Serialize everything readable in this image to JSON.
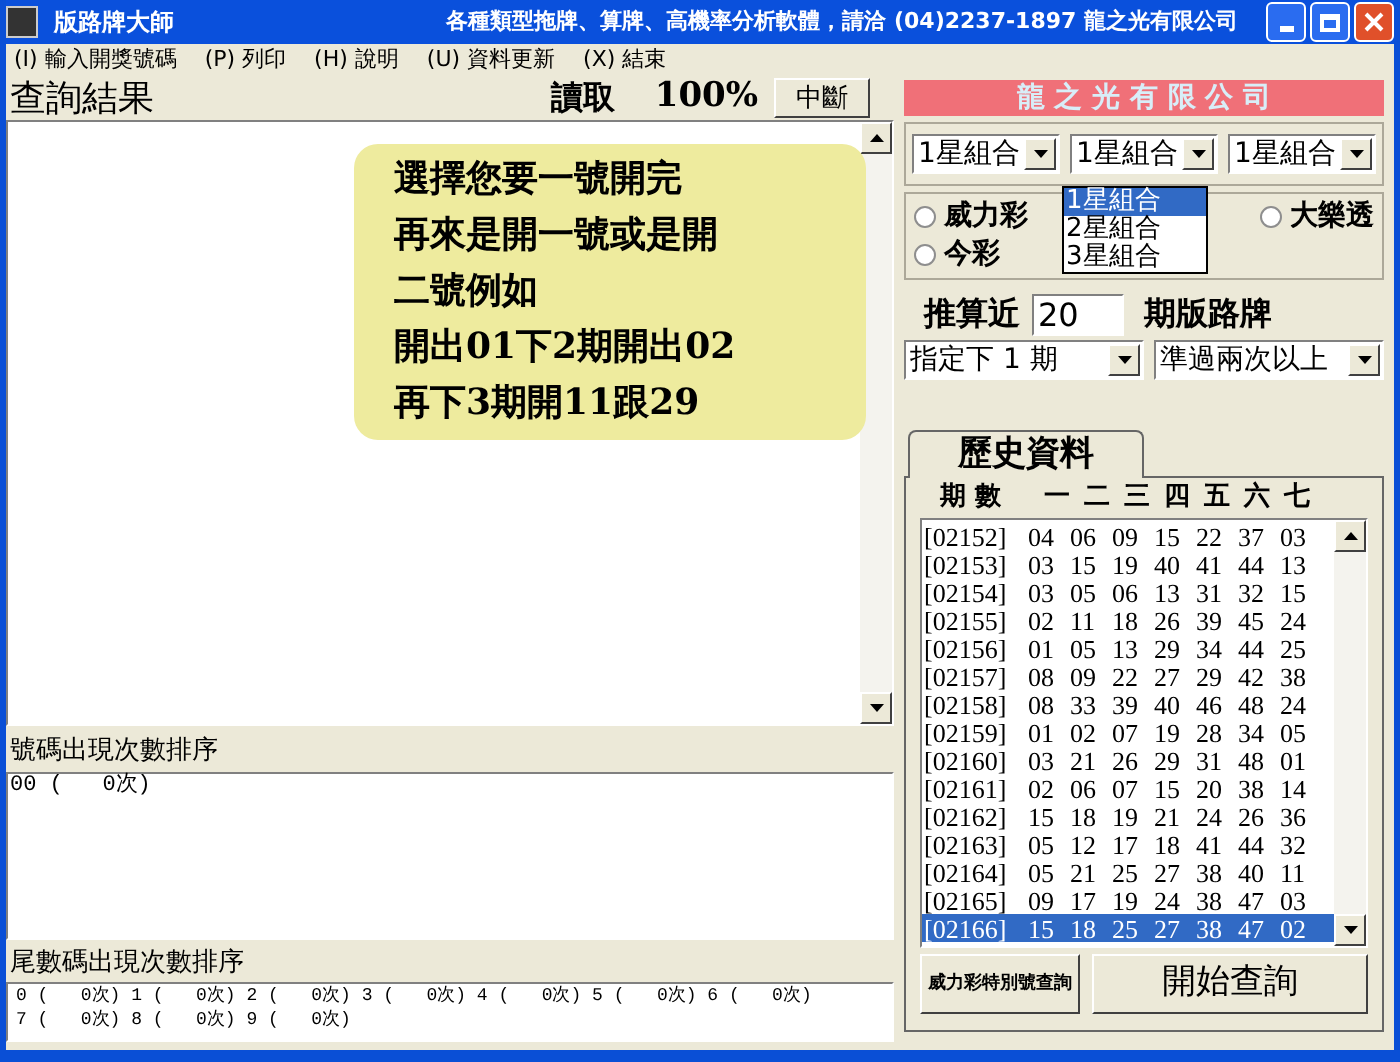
{
  "window": {
    "title": "版路牌大師",
    "caption": "各種類型拖牌、算牌、高機率分析軟體，請洽  (04)2237-1897  龍之光有限公司"
  },
  "menu": [
    {
      "key": "(I)",
      "label": "輸入開獎號碼"
    },
    {
      "key": "(P)",
      "label": "列印"
    },
    {
      "key": "(H)",
      "label": "說明"
    },
    {
      "key": "(U)",
      "label": "資料更新"
    },
    {
      "key": "(X)",
      "label": "結束"
    }
  ],
  "results": {
    "title": "查詢結果",
    "status": "讀取",
    "percent": "100%",
    "stop_button": "中斷"
  },
  "tooltip": {
    "lines": [
      "選擇您要一號開完",
      "再來是開一號或是開",
      "二號例如",
      "開出01下2期開出02",
      "再下3期開11跟29"
    ]
  },
  "number_counts": {
    "title": "號碼出現次數排序",
    "lines": [
      "00 (   0次)"
    ]
  },
  "tail_counts": {
    "title": "尾數碼出現次數排序",
    "lines": [
      "0 (   0次) 1 (   0次) 2 (   0次) 3 (   0次) 4 (   0次) 5 (   0次) 6 (   0次)",
      "7 (   0次) 8 (   0次) 9 (   0次)"
    ]
  },
  "company": "龍 之 光 有 限 公 司",
  "combos": [
    {
      "value": "1星組合"
    },
    {
      "value": "1星組合",
      "expanded": true
    },
    {
      "value": "1星組合"
    }
  ],
  "combo_options": [
    {
      "label": "1星組合",
      "selected": true
    },
    {
      "label": "2星組合",
      "selected": false
    },
    {
      "label": "3星組合",
      "selected": false
    }
  ],
  "games": [
    {
      "label": "威力彩",
      "selected": false
    },
    {
      "label": "今彩",
      "selected": false
    },
    {
      "label": "大樂透",
      "selected": false
    }
  ],
  "recent": {
    "label": "推算近",
    "value": "20",
    "suffix": "期版路牌"
  },
  "filters": [
    {
      "value": "指定下 1 期"
    },
    {
      "value": "準過兩次以上"
    }
  ],
  "history": {
    "tab": "歷史資料",
    "columns": [
      "期 數",
      "一",
      "二",
      "三",
      "四",
      "五",
      "六",
      "七"
    ],
    "rows": [
      {
        "period": "[02152]",
        "numbers": [
          "04",
          "06",
          "09",
          "15",
          "22",
          "37",
          "03"
        ],
        "selected": false
      },
      {
        "period": "[02153]",
        "numbers": [
          "03",
          "15",
          "19",
          "40",
          "41",
          "44",
          "13"
        ],
        "selected": false
      },
      {
        "period": "[02154]",
        "numbers": [
          "03",
          "05",
          "06",
          "13",
          "31",
          "32",
          "15"
        ],
        "selected": false
      },
      {
        "period": "[02155]",
        "numbers": [
          "02",
          "11",
          "18",
          "26",
          "39",
          "45",
          "24"
        ],
        "selected": false
      },
      {
        "period": "[02156]",
        "numbers": [
          "01",
          "05",
          "13",
          "29",
          "34",
          "44",
          "25"
        ],
        "selected": false
      },
      {
        "period": "[02157]",
        "numbers": [
          "08",
          "09",
          "22",
          "27",
          "29",
          "42",
          "38"
        ],
        "selected": false
      },
      {
        "period": "[02158]",
        "numbers": [
          "08",
          "33",
          "39",
          "40",
          "46",
          "48",
          "24"
        ],
        "selected": false
      },
      {
        "period": "[02159]",
        "numbers": [
          "01",
          "02",
          "07",
          "19",
          "28",
          "34",
          "05"
        ],
        "selected": false
      },
      {
        "period": "[02160]",
        "numbers": [
          "03",
          "21",
          "26",
          "29",
          "31",
          "48",
          "01"
        ],
        "selected": false
      },
      {
        "period": "[02161]",
        "numbers": [
          "02",
          "06",
          "07",
          "15",
          "20",
          "38",
          "14"
        ],
        "selected": false
      },
      {
        "period": "[02162]",
        "numbers": [
          "15",
          "18",
          "19",
          "21",
          "24",
          "26",
          "36"
        ],
        "selected": false
      },
      {
        "period": "[02163]",
        "numbers": [
          "05",
          "12",
          "17",
          "18",
          "41",
          "44",
          "32"
        ],
        "selected": false
      },
      {
        "period": "[02164]",
        "numbers": [
          "05",
          "21",
          "25",
          "27",
          "38",
          "40",
          "11"
        ],
        "selected": false
      },
      {
        "period": "[02165]",
        "numbers": [
          "09",
          "17",
          "19",
          "24",
          "38",
          "47",
          "03"
        ],
        "selected": false
      },
      {
        "period": "[02166]",
        "numbers": [
          "15",
          "18",
          "25",
          "27",
          "38",
          "47",
          "02"
        ],
        "selected": true
      }
    ]
  },
  "buttons": [
    {
      "label": "威力彩特別號查詢",
      "kind": "small"
    },
    {
      "label": "開始查詢",
      "kind": "large"
    }
  ]
}
